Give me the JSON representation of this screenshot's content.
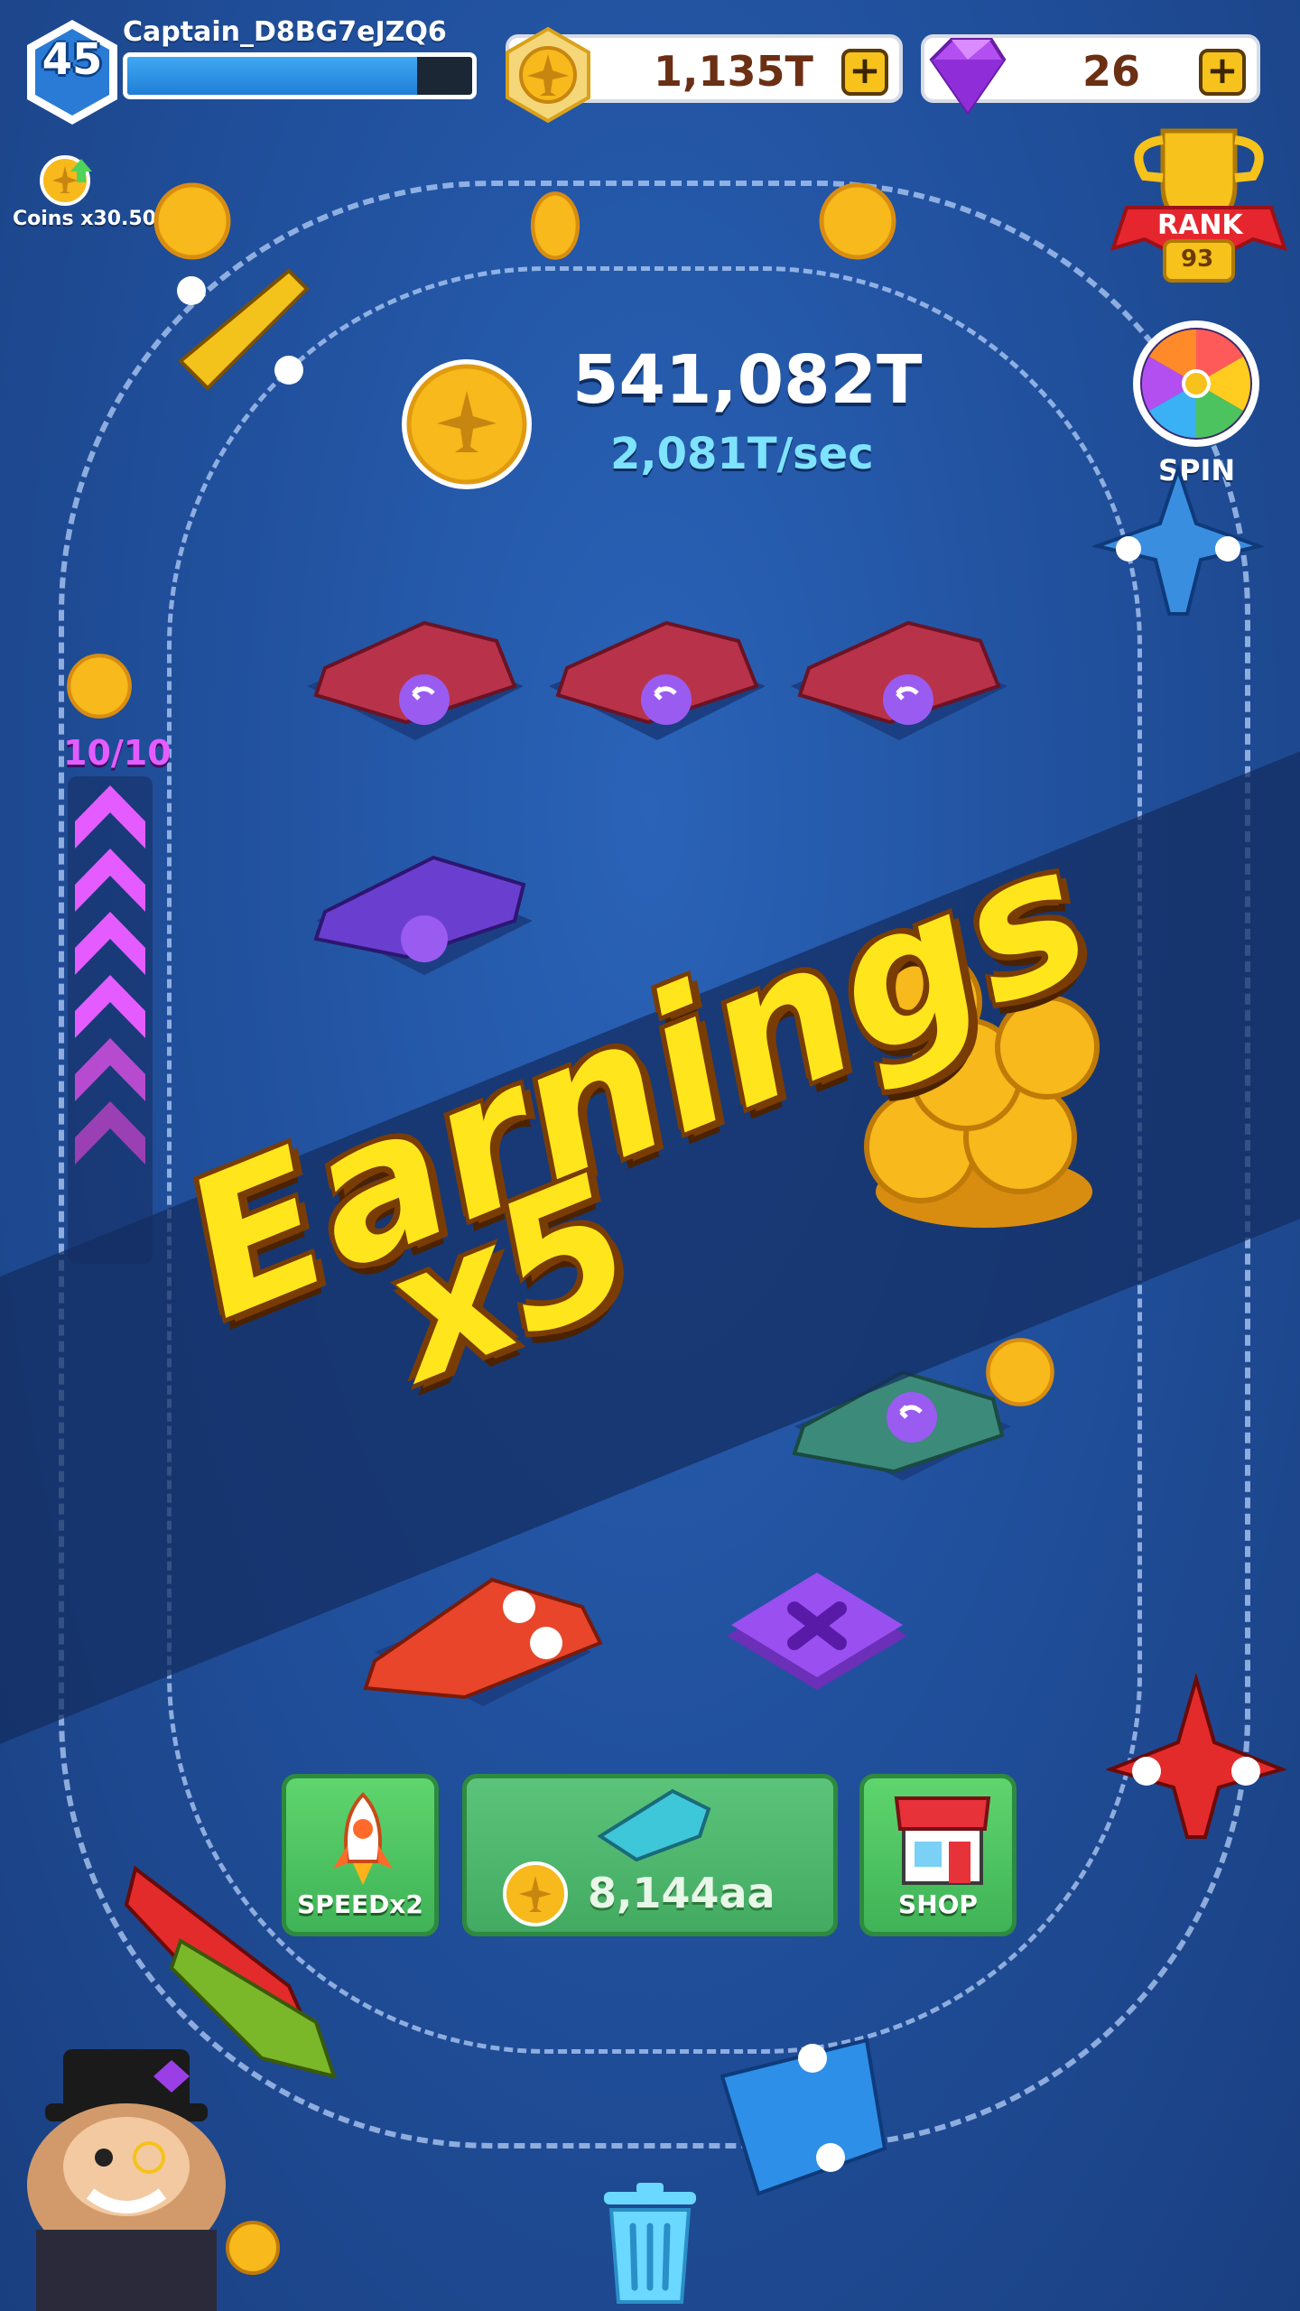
{
  "player": {
    "level": "45",
    "name": "Captain_D8BG7eJZQ6",
    "xp_progress": 0.84
  },
  "resources": {
    "coins": "1,135T",
    "gems": "26",
    "plus_symbol": "+"
  },
  "bonus": {
    "coins_multiplier_label": "Coins x30.50"
  },
  "rank": {
    "label": "RANK",
    "value": "93"
  },
  "spin": {
    "label": "SPIN"
  },
  "earnings": {
    "total": "541,082T",
    "rate": "2,081T/sec"
  },
  "boost": {
    "count": "10/10"
  },
  "banner": {
    "line1": "Earnings",
    "line2": "x5"
  },
  "buttons": {
    "speed_label": "SPEEDx2",
    "buy_price": "8,144aa",
    "shop_label": "SHOP",
    "delete_symbol": "✕"
  },
  "icons": {
    "level": "hexagon-badge-icon",
    "coin": "plane-coin-icon",
    "gem": "gem-icon",
    "rank": "trophy-icon",
    "spin": "wheel-icon",
    "speed": "rocket-icon",
    "shop": "shop-icon",
    "trash": "trash-icon",
    "undo": "undo-icon"
  },
  "colors": {
    "coin_gold": "#f7b91b",
    "gem_purple": "#a53fe6",
    "button_green": "#4cc35f",
    "delete_purple": "#8a3fe0",
    "banner_yellow": "#ffe61c"
  }
}
